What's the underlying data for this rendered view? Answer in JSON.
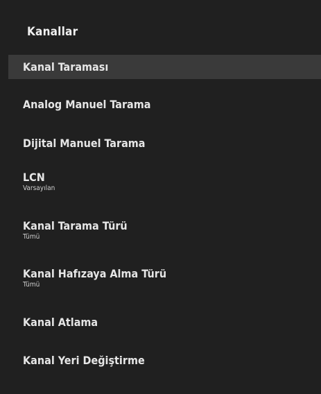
{
  "panel": {
    "title": "Kanallar"
  },
  "menu": {
    "items": [
      {
        "label": "Kanal Taraması",
        "sub": ""
      },
      {
        "label": "Analog Manuel Tarama",
        "sub": ""
      },
      {
        "label": "Dijital Manuel Tarama",
        "sub": ""
      },
      {
        "label": "LCN",
        "sub": "Varsayılan"
      },
      {
        "label": "Kanal Tarama Türü",
        "sub": "Tümü"
      },
      {
        "label": "Kanal Hafızaya Alma Türü",
        "sub": "Tümü"
      },
      {
        "label": "Kanal Atlama",
        "sub": ""
      },
      {
        "label": "Kanal Yeri Değiştirme",
        "sub": ""
      }
    ],
    "selected_index": 0
  }
}
